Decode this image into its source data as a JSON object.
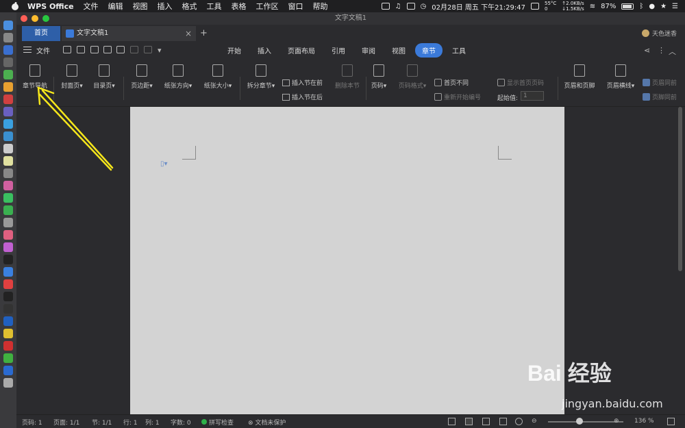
{
  "menubar": {
    "app_name": "WPS Office",
    "menus": [
      "文件",
      "编辑",
      "视图",
      "插入",
      "格式",
      "工具",
      "表格",
      "工作区",
      "窗口",
      "帮助"
    ],
    "datetime": "02月28日 周五 下午21:29:47",
    "temp": "55°C",
    "temp_sub": "0",
    "net_up": "↑2.0KB/s",
    "net_down": "↓1.5KB/s",
    "battery": "87%"
  },
  "window": {
    "title": "文字文稿1"
  },
  "tabs": {
    "home_label": "首页",
    "doc_label": "文字文稿1",
    "close_glyph": "×",
    "add_glyph": "+",
    "user_name": "天色迷香"
  },
  "menurow": {
    "file_label": "文件",
    "tabs": [
      "开始",
      "插入",
      "页面布局",
      "引用",
      "审阅",
      "视图",
      "章节",
      "工具"
    ],
    "active_tab": "章节"
  },
  "ribbon": {
    "chapter_nav": "章节导航",
    "cover_page": "封面页",
    "toc_page": "目录页",
    "margins": "页边距",
    "orientation": "纸张方向",
    "paper_size": "纸张大小",
    "split_chapter": "拆分章节",
    "insert_before": "插入节在前",
    "insert_after": "插入节在后",
    "delete_section": "删除本节",
    "page_number": "页码",
    "page_num_format": "页码格式",
    "first_page_diff": "首页不同",
    "restart_numbering": "重新开始编号",
    "show_first_page_num": "显示首页页码",
    "start_value_label": "起始值:",
    "start_value": "1",
    "header_footer": "页眉和页脚",
    "header_line": "页眉横线",
    "header_same": "页眉同前",
    "footer_same": "页脚同前"
  },
  "status": {
    "page_num": "页码: 1",
    "pages": "页面: 1/1",
    "section": "节: 1/1",
    "row": "行: 1",
    "col": "列: 1",
    "word_count": "字数: 0",
    "spell_check": "拼写检查",
    "doc_protect": "文档未保护",
    "zoom": "136 %"
  },
  "watermark": {
    "brand": "Bai 经验",
    "url": "jingyan.baidu.com"
  },
  "colors": {
    "accent": "#3b7ad9",
    "annotation_arrow": "#f5e61b"
  }
}
